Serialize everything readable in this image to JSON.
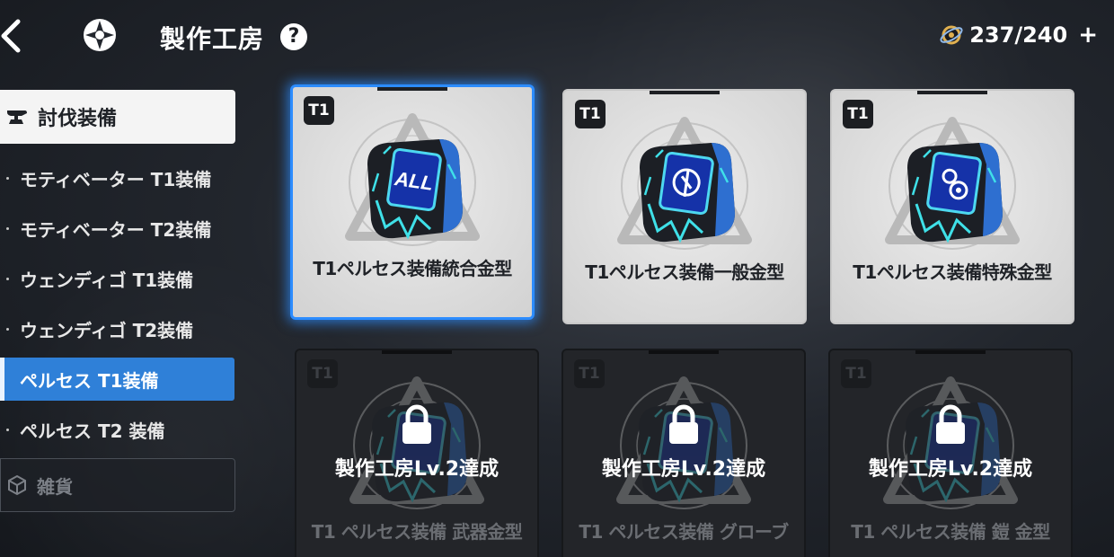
{
  "header": {
    "title": "製作工房",
    "help_label": "?",
    "stamina": "237/240",
    "plus_label": "+"
  },
  "sidebar": {
    "main_category": "討伐装備",
    "items": [
      {
        "label": "モティベーター T1装備",
        "active": false
      },
      {
        "label": "モティベーター T2装備",
        "active": false
      },
      {
        "label": "ウェンディゴ T1装備",
        "active": false
      },
      {
        "label": "ウェンディゴ T2装備",
        "active": false
      },
      {
        "label": "ペルセス T1装備",
        "active": true
      },
      {
        "label": "ペルセス T2 装備",
        "active": false
      }
    ],
    "misc_category": "雑貨"
  },
  "cards": [
    {
      "tier": "T1",
      "name": "T1ペルセス装備統合金型",
      "emblem": "ALL",
      "locked": false,
      "selected": true
    },
    {
      "tier": "T1",
      "name": "T1ペルセス装備一般金型",
      "emblem": "general-icon",
      "locked": false,
      "selected": false
    },
    {
      "tier": "T1",
      "name": "T1ペルセス装備特殊金型",
      "emblem": "special-icon",
      "locked": false,
      "selected": false
    },
    {
      "tier": "T1",
      "name": "T1 ペルセス装備 武器金型",
      "lock_text": "製作工房Lv.2達成",
      "locked": true
    },
    {
      "tier": "T1",
      "name": "T1 ペルセス装備 グローブ",
      "lock_text": "製作工房Lv.2達成",
      "locked": true
    },
    {
      "tier": "T1",
      "name": "T1 ペルセス装備 鎧 金型",
      "lock_text": "製作工房Lv.2達成",
      "locked": true
    }
  ],
  "colors": {
    "accent": "#2f80d8",
    "selection_glow": "#2c8cff",
    "card_light": "#dcdcdc",
    "card_dark": "#232529"
  }
}
